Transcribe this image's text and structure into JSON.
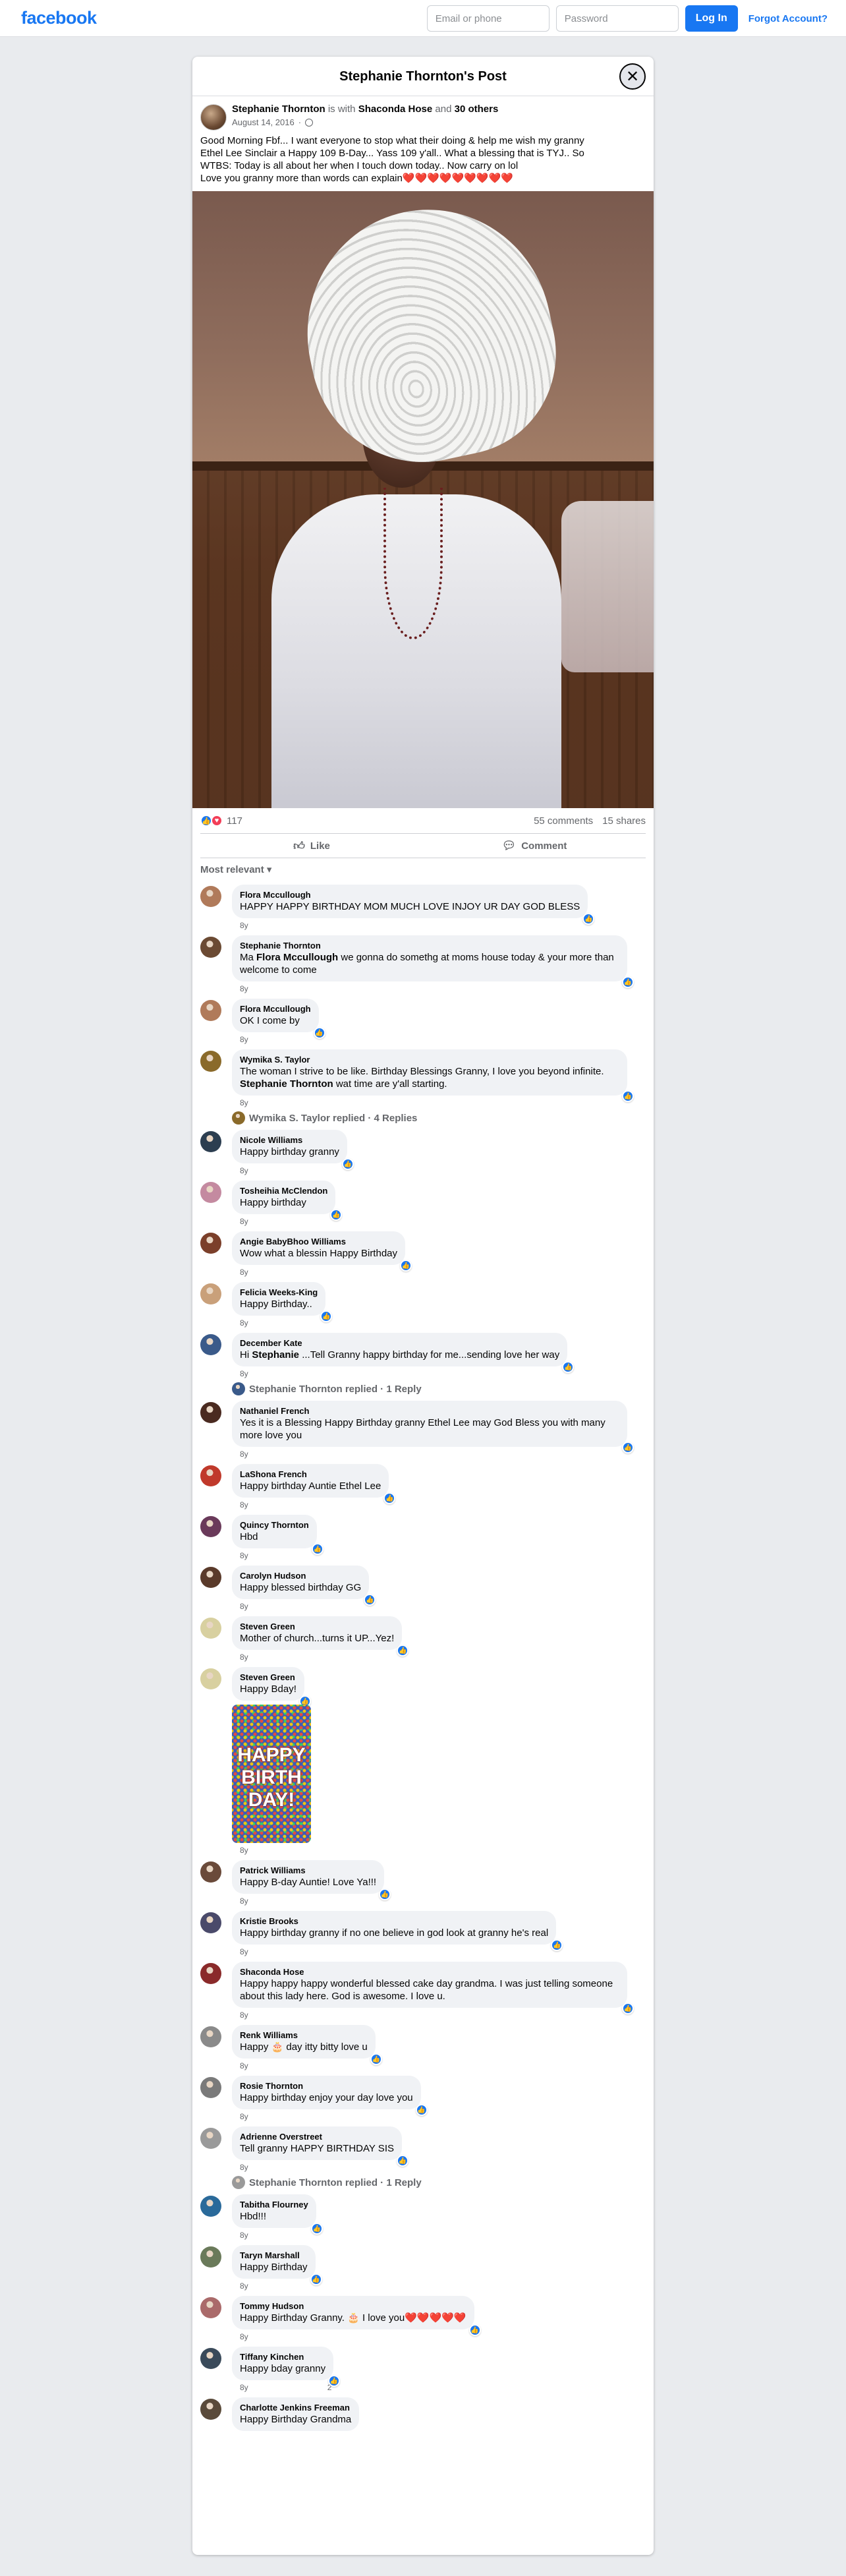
{
  "topbar": {
    "logo": "facebook",
    "email_placeholder": "Email or phone",
    "password_placeholder": "Password",
    "login_label": "Log In",
    "forgot_label": "Forgot Account?"
  },
  "post": {
    "title": "Stephanie Thornton's Post",
    "author": "Stephanie Thornton",
    "with_text": "is with",
    "tagged": "Shaconda Hose",
    "and_text": "and",
    "others": "30 others",
    "date": "August 14, 2016",
    "text_lines": [
      "Good Morning Fbf... I want everyone to stop what their doing & help me wish my granny",
      "Ethel Lee Sinclair a Happy 109 B-Day... Yass 109 y'all.. What a blessing that is TYJ.. So",
      "WTBS: Today is all about her when I touch down today.. Now carry on lol",
      "Love you granny more than words can explain❤️❤️❤️❤️❤️❤️❤️❤️❤️"
    ],
    "reactions_count": "117",
    "comments_count": "55 comments",
    "shares_count": "15 shares",
    "like_label": "Like",
    "comment_label": "Comment",
    "sort_label": "Most relevant"
  },
  "comments": [
    {
      "name": "Flora Mccullough",
      "text": "HAPPY HAPPY BIRTHDAY MOM MUCH LOVE INJOY UR DAY GOD BLESS",
      "time": "8y",
      "color": "#b07a5a"
    },
    {
      "name": "Stephanie Thornton",
      "text_parts": [
        "Ma ",
        "Flora Mccullough",
        " we gonna do somethg at moms house today & your more than welcome to come"
      ],
      "time": "8y",
      "color": "#6b4a33"
    },
    {
      "name": "Flora Mccullough",
      "text": "OK I come by",
      "time": "8y",
      "color": "#b07a5a"
    },
    {
      "name": "Wymika S. Taylor",
      "text_parts": [
        "The woman I strive to be like. Birthday Blessings Granny, I love you beyond infinite. ",
        "Stephanie Thornton",
        " wat time are y'all starting."
      ],
      "time": "8y",
      "color": "#8a6a2a",
      "reply": "Wymika S. Taylor replied · 4 Replies"
    },
    {
      "name": "Nicole Williams",
      "text": "Happy birthday granny",
      "time": "8y",
      "color": "#2c3e50"
    },
    {
      "name": "Tosheihia McClendon",
      "text": "Happy birthday",
      "time": "8y",
      "color": "#c48aa0"
    },
    {
      "name": "Angie BabyBhoo Williams",
      "text": "Wow what a blessin Happy Birthday",
      "time": "8y",
      "color": "#7b3f2a"
    },
    {
      "name": "Felicia Weeks-King",
      "text": "Happy Birthday..",
      "time": "8y",
      "color": "#c9a07a"
    },
    {
      "name": "December Kate",
      "text_parts": [
        "Hi ",
        "Stephanie",
        " ...Tell Granny happy birthday for me...sending love her way"
      ],
      "time": "8y",
      "color": "#3a5a8a",
      "reply": "Stephanie Thornton replied · 1 Reply"
    },
    {
      "name": "Nathaniel French",
      "text": "Yes it is a Blessing Happy Birthday granny Ethel Lee may God Bless you with many more love you",
      "time": "8y",
      "color": "#4a2a20"
    },
    {
      "name": "LaShona French",
      "text": "Happy birthday Auntie Ethel Lee",
      "time": "8y",
      "color": "#c0392b"
    },
    {
      "name": "Quincy Thornton",
      "text": "Hbd",
      "time": "8y",
      "color": "#6a3a5a"
    },
    {
      "name": "Carolyn Hudson",
      "text": "Happy blessed birthday GG",
      "time": "8y",
      "color": "#5a3a2a"
    },
    {
      "name": "Steven Green",
      "text": "Mother of church...turns it UP...Yez!",
      "time": "8y",
      "color": "#d8d0a0"
    },
    {
      "name": "Steven Green",
      "text": "Happy Bday!",
      "time": "8y",
      "color": "#d8d0a0",
      "gif_text": "HAPPY BIRTH DAY!"
    },
    {
      "name": "Patrick Williams",
      "text": "Happy B-day Auntie! Love Ya!!!",
      "time": "8y",
      "color": "#6a4a3a"
    },
    {
      "name": "Kristie Brooks",
      "text": "Happy birthday granny if no one believe in god look at granny he's real",
      "time": "8y",
      "color": "#4a4a6a"
    },
    {
      "name": "Shaconda Hose",
      "text": "Happy happy happy wonderful blessed cake day grandma. I was just telling someone about this lady here. God is awesome. I love u.",
      "time": "8y",
      "color": "#8a2a2a"
    },
    {
      "name": "Renk Williams",
      "text": "Happy 🎂 day itty bitty love u",
      "time": "8y",
      "color": "#8a8a8a"
    },
    {
      "name": "Rosie Thornton",
      "text": "Happy birthday enjoy your day love you",
      "time": "8y",
      "color": "#7a7a7a"
    },
    {
      "name": "Adrienne Overstreet",
      "text": "Tell granny HAPPY BIRTHDAY SIS",
      "time": "8y",
      "color": "#9a9a9a",
      "reply": "Stephanie Thornton replied · 1 Reply"
    },
    {
      "name": "Tabitha Flourney",
      "text": "Hbd!!!",
      "time": "8y",
      "color": "#2a6a9a"
    },
    {
      "name": "Taryn Marshall",
      "text": "Happy Birthday",
      "time": "8y",
      "color": "#6a7a5a"
    },
    {
      "name": "Tommy Hudson",
      "text": "Happy Birthday Granny. 🎂 I love you❤️❤️❤️❤️❤️",
      "time": "8y",
      "color": "#aa6a6a"
    },
    {
      "name": "Tiffany Kinchen",
      "text": "Happy bday granny",
      "time": "8y",
      "color": "#3a4a5a",
      "like_count": "2"
    },
    {
      "name": "Charlotte Jenkins Freeman",
      "text": "Happy Birthday Grandma",
      "time": "",
      "color": "#5a4a3a"
    }
  ]
}
